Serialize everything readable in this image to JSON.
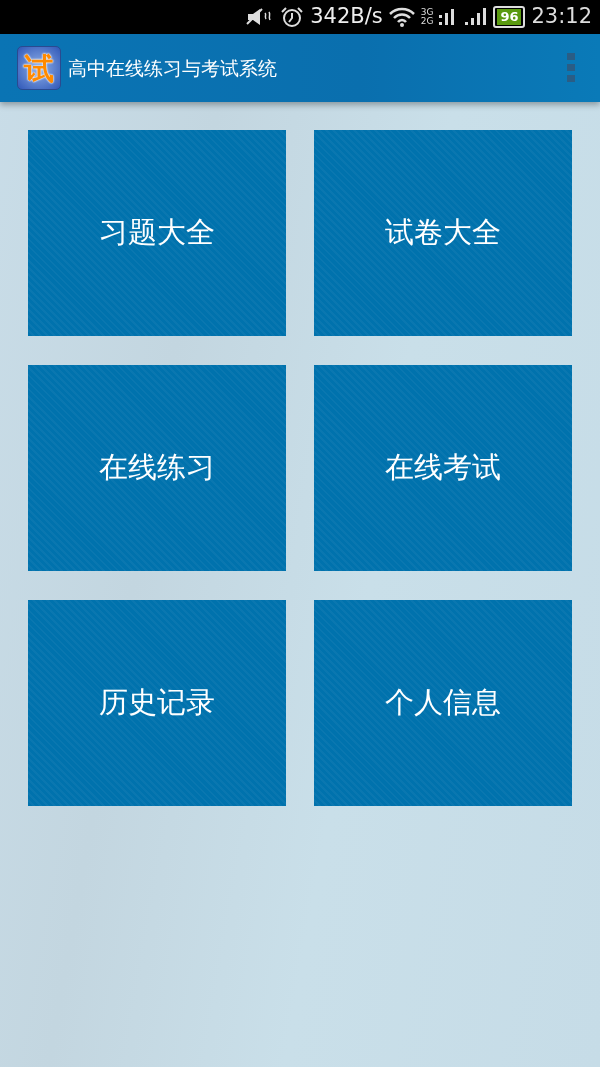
{
  "status_bar": {
    "network_speed": "342B/s",
    "mobile_labels": [
      "3G",
      "2G"
    ],
    "battery": "96",
    "time": "23:12"
  },
  "app_bar": {
    "logo": "试",
    "title": "高中在线练习与考试系统"
  },
  "tiles": [
    {
      "label": "习题大全"
    },
    {
      "label": "试卷大全"
    },
    {
      "label": "在线练习"
    },
    {
      "label": "在线考试"
    },
    {
      "label": "历史记录"
    },
    {
      "label": "个人信息"
    }
  ]
}
